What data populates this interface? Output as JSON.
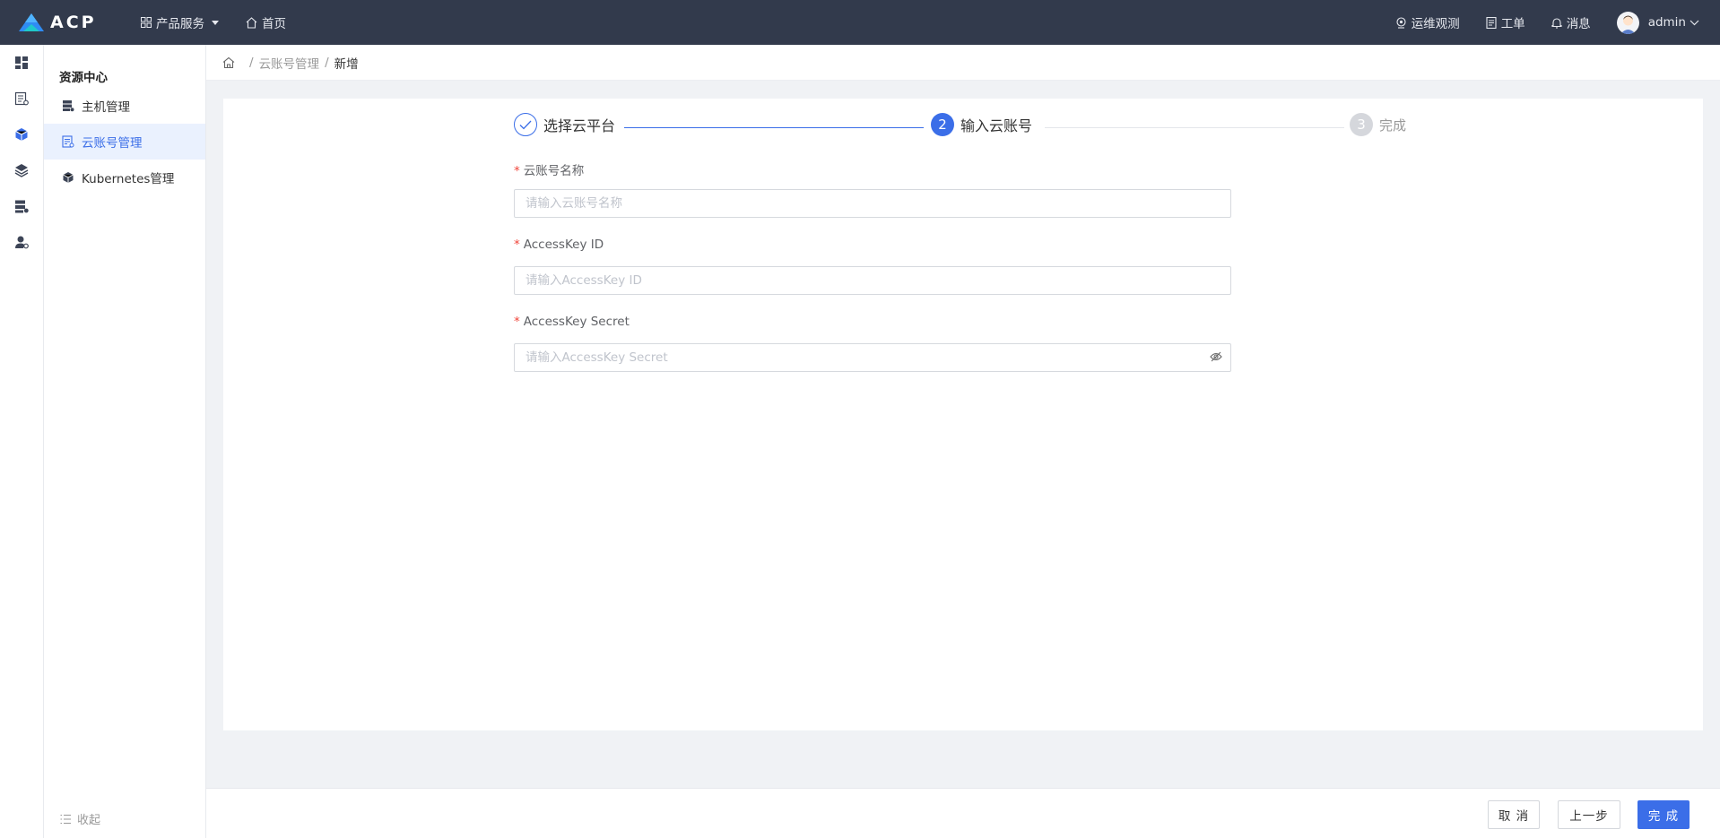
{
  "app": {
    "logo_text": "ACP"
  },
  "topnav": {
    "products_label": "产品服务",
    "home_label": "首页"
  },
  "topright": {
    "ops_label": "运维观测",
    "ticket_label": "工单",
    "message_label": "消息",
    "user_name": "admin"
  },
  "sidebar": {
    "title": "资源中心",
    "items": [
      {
        "label": "主机管理",
        "icon": "server-icon"
      },
      {
        "label": "云账号管理",
        "icon": "cloud-account-icon"
      },
      {
        "label": "Kubernetes管理",
        "icon": "cube-icon"
      }
    ],
    "active_index": 1,
    "collapse_label": "收起"
  },
  "rail": [
    "dashboard-icon",
    "list-icon",
    "cube-icon",
    "layers-icon",
    "server-icon",
    "user-settings-icon"
  ],
  "breadcrumb": {
    "parent": "云账号管理",
    "current": "新增"
  },
  "steps": [
    {
      "number": "1",
      "label": "选择云平台",
      "status": "done"
    },
    {
      "number": "2",
      "label": "输入云账号",
      "status": "active"
    },
    {
      "number": "3",
      "label": "完成",
      "status": "wait"
    }
  ],
  "form": {
    "name": {
      "label": "云账号名称",
      "placeholder": "请输入云账号名称",
      "value": ""
    },
    "ak_id": {
      "label": "AccessKey ID",
      "placeholder": "请输入AccessKey ID",
      "value": ""
    },
    "ak_secret": {
      "label": "AccessKey Secret",
      "placeholder": "请输入AccessKey Secret",
      "value": ""
    }
  },
  "footer": {
    "cancel_label": "取 消",
    "prev_label": "上一步",
    "finish_label": "完 成"
  },
  "colors": {
    "topbar": "#323a4c",
    "accent": "#3b6ee8",
    "required": "#f0463b"
  }
}
